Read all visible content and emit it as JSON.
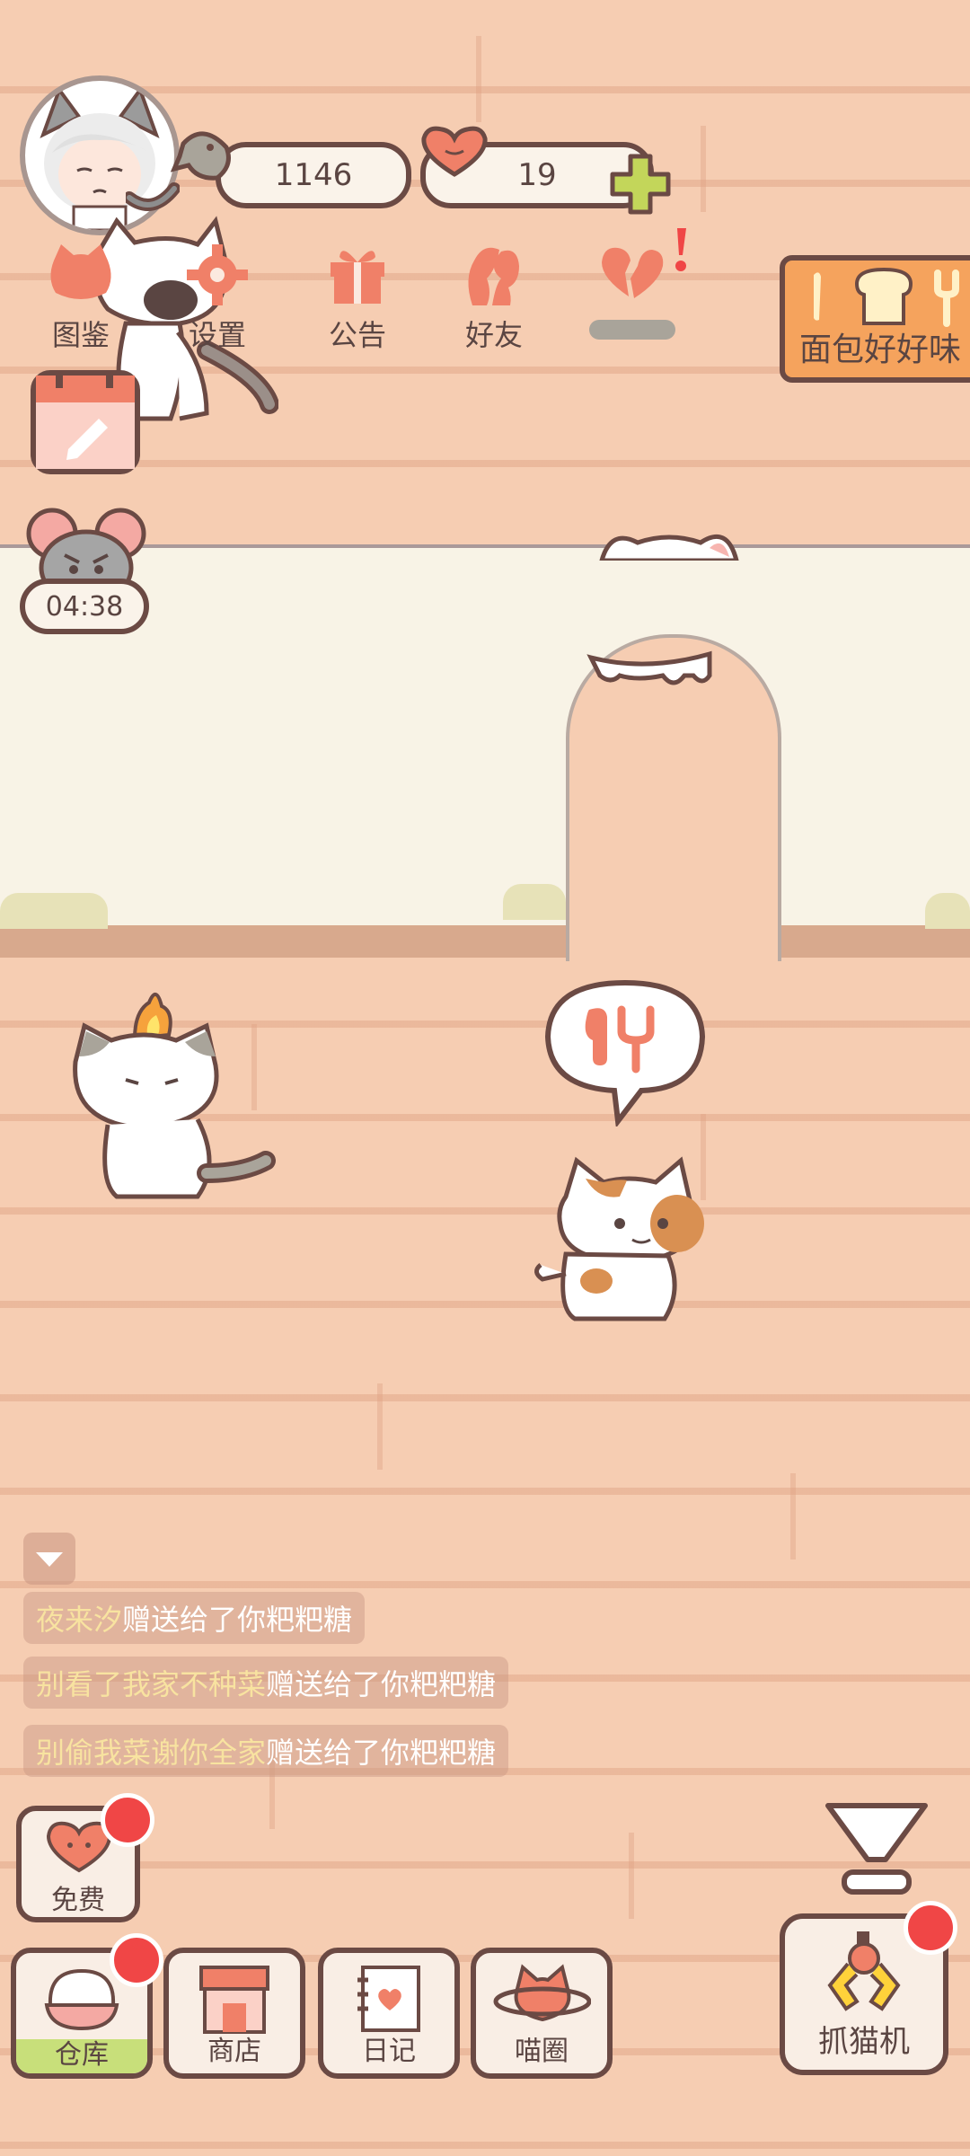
{
  "stats": {
    "fish": "1146",
    "hearts": "19"
  },
  "menu": [
    {
      "label": "图鉴",
      "icon": "cat-head-icon"
    },
    {
      "label": "设置",
      "icon": "gear-icon"
    },
    {
      "label": "公告",
      "icon": "gift-icon"
    },
    {
      "label": "好友",
      "icon": "friends-icon"
    },
    {
      "label": "",
      "icon": "broken-heart-icon"
    }
  ],
  "event_banner": {
    "label": "面包好好味"
  },
  "timer": {
    "value": "04:38"
  },
  "chat": [
    {
      "user": "夜来汐",
      "text": "赠送给了你粑粑糖"
    },
    {
      "user": "别看了我家不种菜",
      "text": "赠送给了你粑粑糖"
    },
    {
      "user": "别偷我菜谢你全家",
      "text": "赠送给了你粑粑糖"
    }
  ],
  "free": {
    "label": "免费"
  },
  "bottom_nav": [
    {
      "label": "仓库"
    },
    {
      "label": "商店"
    },
    {
      "label": "日记"
    },
    {
      "label": "喵圈"
    }
  ],
  "claw": {
    "label": "抓猫机"
  },
  "colors": {
    "accent": "#f08068",
    "outline": "#6b4a44",
    "badge": "#f04646",
    "wall": "#f8f3e6"
  }
}
